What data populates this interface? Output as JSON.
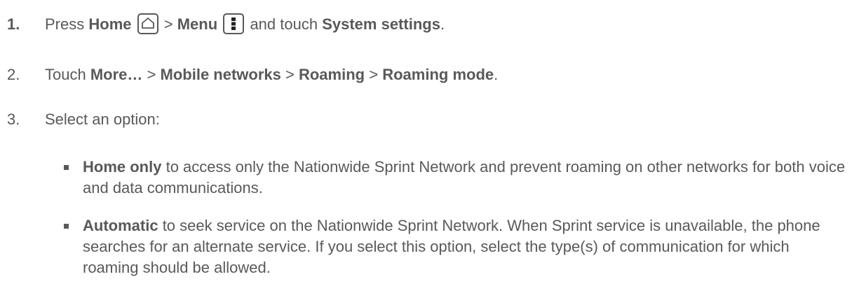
{
  "steps": [
    {
      "number": "1.",
      "press": "Press",
      "home_label": "Home",
      "home_icon": "home-icon",
      "sep": ">",
      "menu_label": "Menu",
      "menu_icon": "menu-icon",
      "and_touch": "and touch",
      "target": "System settings",
      "end": "."
    },
    {
      "number": "2.",
      "touch": "Touch",
      "more": "More…",
      "sep1": ">",
      "mobile_networks": "Mobile networks",
      "sep2": ">",
      "roaming": "Roaming",
      "sep3": ">",
      "roaming_mode": "Roaming mode",
      "end": "."
    },
    {
      "number": "3.",
      "text": "Select an option:"
    }
  ],
  "options": [
    {
      "term": "Home only",
      "description": "to access only the Nationwide Sprint Network and prevent roaming on other networks for both voice and data communications."
    },
    {
      "term": "Automatic",
      "description": "to seek service on the Nationwide Sprint Network. When Sprint service is unavailable, the phone searches for an alternate service. If you select this option, select the type(s) of communication for which roaming should be allowed."
    }
  ]
}
